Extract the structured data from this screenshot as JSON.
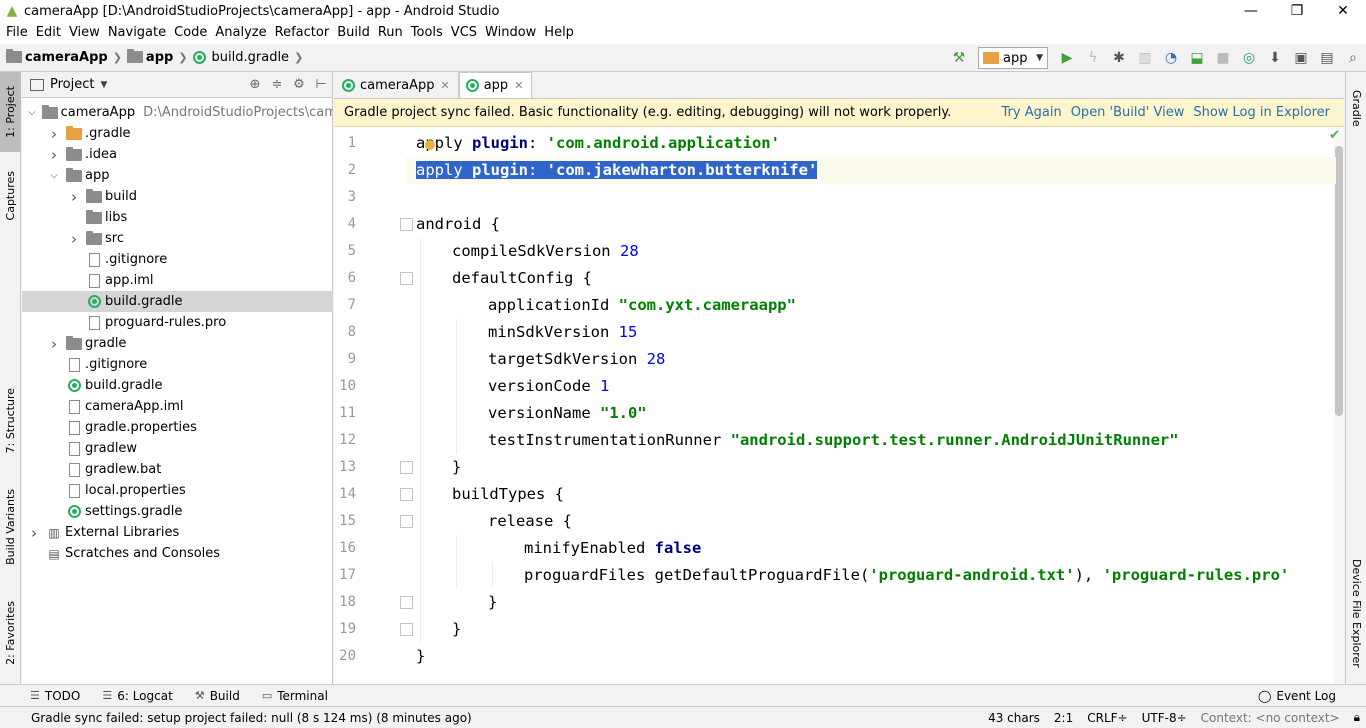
{
  "window": {
    "title": "cameraApp [D:\\AndroidStudioProjects\\cameraApp] - app - Android Studio",
    "minimize": "—",
    "maximize": "❐",
    "close": "✕"
  },
  "menu": [
    "File",
    "Edit",
    "View",
    "Navigate",
    "Code",
    "Analyze",
    "Refactor",
    "Build",
    "Run",
    "Tools",
    "VCS",
    "Window",
    "Help"
  ],
  "breadcrumb": {
    "project": "cameraApp",
    "module": "app",
    "file": "build.gradle"
  },
  "toolbar": {
    "run_config": "app"
  },
  "left_tabs": {
    "project": "1: Project",
    "captures": "Captures",
    "structure": "7: Structure",
    "build_variants": "Build Variants",
    "favorites": "2: Favorites"
  },
  "right_tabs": {
    "gradle": "Gradle",
    "device_file_explorer": "Device File Explorer"
  },
  "project_panel": {
    "title": "Project",
    "tree": [
      {
        "label": "cameraApp",
        "path": "D:\\AndroidStudioProjects\\cameraApp",
        "depth": 0,
        "arrow": "open",
        "icon": "folder"
      },
      {
        "label": ".gradle",
        "depth": 1,
        "arrow": "closed",
        "icon": "folder-orange"
      },
      {
        "label": ".idea",
        "depth": 1,
        "arrow": "closed",
        "icon": "folder"
      },
      {
        "label": "app",
        "depth": 1,
        "arrow": "open",
        "icon": "folder"
      },
      {
        "label": "build",
        "depth": 2,
        "arrow": "closed",
        "icon": "folder"
      },
      {
        "label": "libs",
        "depth": 2,
        "arrow": "none",
        "icon": "folder"
      },
      {
        "label": "src",
        "depth": 2,
        "arrow": "closed",
        "icon": "folder"
      },
      {
        "label": ".gitignore",
        "depth": 2,
        "arrow": "none",
        "icon": "file"
      },
      {
        "label": "app.iml",
        "depth": 2,
        "arrow": "none",
        "icon": "file"
      },
      {
        "label": "build.gradle",
        "depth": 2,
        "arrow": "none",
        "icon": "gradle",
        "selected": true
      },
      {
        "label": "proguard-rules.pro",
        "depth": 2,
        "arrow": "none",
        "icon": "file"
      },
      {
        "label": "gradle",
        "depth": 1,
        "arrow": "closed",
        "icon": "folder"
      },
      {
        "label": ".gitignore",
        "depth": 1,
        "arrow": "none",
        "icon": "file"
      },
      {
        "label": "build.gradle",
        "depth": 1,
        "arrow": "none",
        "icon": "gradle"
      },
      {
        "label": "cameraApp.iml",
        "depth": 1,
        "arrow": "none",
        "icon": "file"
      },
      {
        "label": "gradle.properties",
        "depth": 1,
        "arrow": "none",
        "icon": "file"
      },
      {
        "label": "gradlew",
        "depth": 1,
        "arrow": "none",
        "icon": "file"
      },
      {
        "label": "gradlew.bat",
        "depth": 1,
        "arrow": "none",
        "icon": "file"
      },
      {
        "label": "local.properties",
        "depth": 1,
        "arrow": "none",
        "icon": "file"
      },
      {
        "label": "settings.gradle",
        "depth": 1,
        "arrow": "none",
        "icon": "gradle"
      },
      {
        "label": "External Libraries",
        "depth": 0,
        "arrow": "closed",
        "icon": "library"
      },
      {
        "label": "Scratches and Consoles",
        "depth": 0,
        "arrow": "none",
        "icon": "scratch"
      }
    ]
  },
  "editor": {
    "tabs": [
      {
        "label": "cameraApp",
        "active": false
      },
      {
        "label": "app",
        "active": true
      }
    ],
    "notice": {
      "message": "Gradle project sync failed. Basic functionality (e.g. editing, debugging) will not work properly.",
      "try_again": "Try Again",
      "open_build": "Open 'Build' View",
      "show_log": "Show Log in Explorer"
    },
    "line_numbers": [
      "1",
      "2",
      "3",
      "4",
      "5",
      "6",
      "7",
      "8",
      "9",
      "10",
      "11",
      "12",
      "13",
      "14",
      "15",
      "16",
      "17",
      "18",
      "19",
      "20"
    ],
    "lines": [
      {
        "indent": 0,
        "parts": [
          [
            "plain",
            "apply "
          ],
          [
            "kw",
            "plugin"
          ],
          [
            "plain",
            ": "
          ],
          [
            "str",
            "'com.android.application'"
          ]
        ]
      },
      {
        "indent": 0,
        "selected": true,
        "parts": [
          [
            "plain",
            "apply "
          ],
          [
            "kw",
            "plugin"
          ],
          [
            "plain",
            ": "
          ],
          [
            "str",
            "'com.jakewharton.butterknife'"
          ]
        ]
      },
      {
        "indent": 0,
        "parts": []
      },
      {
        "indent": 0,
        "parts": [
          [
            "plain",
            "android {"
          ]
        ]
      },
      {
        "indent": 1,
        "parts": [
          [
            "plain",
            "compileSdkVersion "
          ],
          [
            "num",
            "28"
          ]
        ]
      },
      {
        "indent": 1,
        "parts": [
          [
            "plain",
            "defaultConfig {"
          ]
        ]
      },
      {
        "indent": 2,
        "parts": [
          [
            "plain",
            "applicationId "
          ],
          [
            "str",
            "\"com.yxt.cameraapp\""
          ]
        ]
      },
      {
        "indent": 2,
        "parts": [
          [
            "plain",
            "minSdkVersion "
          ],
          [
            "num",
            "15"
          ]
        ]
      },
      {
        "indent": 2,
        "parts": [
          [
            "plain",
            "targetSdkVersion "
          ],
          [
            "num",
            "28"
          ]
        ]
      },
      {
        "indent": 2,
        "parts": [
          [
            "plain",
            "versionCode "
          ],
          [
            "num",
            "1"
          ]
        ]
      },
      {
        "indent": 2,
        "parts": [
          [
            "plain",
            "versionName "
          ],
          [
            "str",
            "\"1.0\""
          ]
        ]
      },
      {
        "indent": 2,
        "parts": [
          [
            "plain",
            "testInstrumentationRunner "
          ],
          [
            "str",
            "\"android.support.test.runner.AndroidJUnitRunner\""
          ]
        ]
      },
      {
        "indent": 1,
        "parts": [
          [
            "plain",
            "}"
          ]
        ]
      },
      {
        "indent": 1,
        "parts": [
          [
            "plain",
            "buildTypes {"
          ]
        ]
      },
      {
        "indent": 2,
        "parts": [
          [
            "plain",
            "release {"
          ]
        ]
      },
      {
        "indent": 3,
        "parts": [
          [
            "plain",
            "minifyEnabled "
          ],
          [
            "kw",
            "false"
          ]
        ]
      },
      {
        "indent": 3,
        "parts": [
          [
            "plain",
            "proguardFiles getDefaultProguardFile("
          ],
          [
            "str",
            "'proguard-android.txt'"
          ],
          [
            "plain",
            "), "
          ],
          [
            "str",
            "'proguard-rules.pro'"
          ]
        ]
      },
      {
        "indent": 2,
        "parts": [
          [
            "plain",
            "}"
          ]
        ]
      },
      {
        "indent": 1,
        "parts": [
          [
            "plain",
            "}"
          ]
        ]
      },
      {
        "indent": 0,
        "parts": [
          [
            "plain",
            "}"
          ]
        ]
      }
    ]
  },
  "bottom_tools": {
    "todo": "TODO",
    "logcat": "6: Logcat",
    "build": "Build",
    "terminal": "Terminal",
    "event_log": "Event Log"
  },
  "status": {
    "message": "Gradle sync failed: setup project failed: null (8 s 124 ms) (8 minutes ago)",
    "chars": "43 chars",
    "position": "2:1",
    "line_sep": "CRLF÷",
    "encoding": "UTF-8÷",
    "context": "Context: <no context>"
  }
}
